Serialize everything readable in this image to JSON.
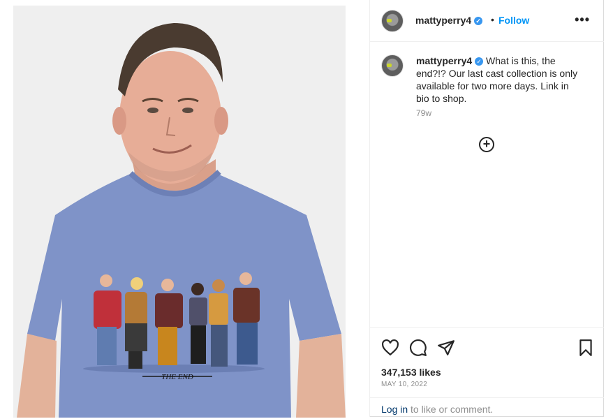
{
  "post": {
    "username": "mattyperry4",
    "verified_mark": "✓",
    "separator": "•",
    "follow_label": "Follow",
    "more_icon": "•••",
    "caption_text": "What is this, the end?!? Our last cast collection is only available for two more days. Link in bio to shop.",
    "caption_age": "79w",
    "add_comment_icon": "+",
    "likes": "347,153 likes",
    "date": "MAY 10, 2022",
    "login_link": "Log in",
    "login_suffix": " to like or comment.",
    "shirt_text": "THE END"
  },
  "icons": [
    "more-options-icon",
    "load-comments-icon",
    "heart-icon",
    "comment-icon",
    "share-icon",
    "save-icon",
    "verified-icon"
  ],
  "colors": {
    "accent": "#0095f6",
    "text": "#262626",
    "muted": "#8e8e8e",
    "shirt": "#7e92c9"
  }
}
